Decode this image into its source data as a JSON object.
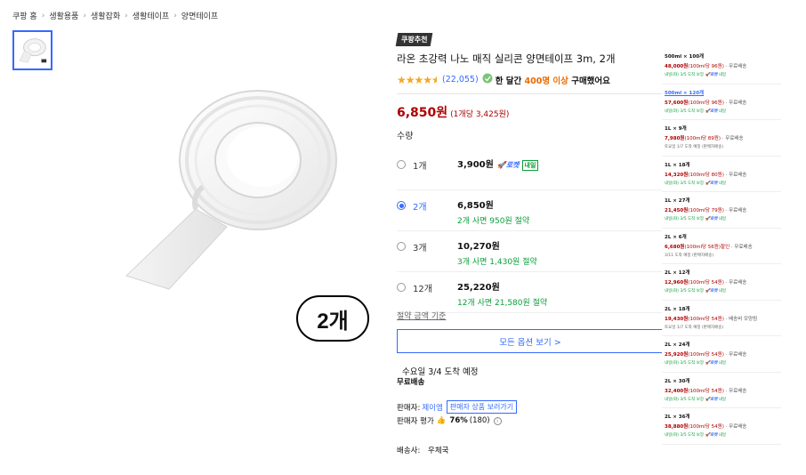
{
  "breadcrumb": [
    "쿠팡 홈",
    "생활용품",
    "생활잡화",
    "생활테이프",
    "양면테이프"
  ],
  "badge_text": "2개",
  "recommend_badge": "쿠팡추천",
  "title": "라온 초강력 나노 매직 실리콘 양면테이프 3m, 2개",
  "rating": {
    "stars": 4.5,
    "review_count": "(22,055)",
    "buy_prefix": "한 달간",
    "buy_highlight": "400명 이상",
    "buy_suffix": "구매했어요"
  },
  "price": {
    "main": "6,850원",
    "unit": "(1개당 3,425원)"
  },
  "quantity_label": "수량",
  "options": [
    {
      "label": "1개",
      "price": "3,900원",
      "save": "",
      "rocket": "로켓",
      "rocket_day": "내일",
      "selected": false
    },
    {
      "label": "2개",
      "price": "6,850원",
      "save": "2개 사면 950원 절약",
      "rocket": "",
      "rocket_day": "",
      "selected": true
    },
    {
      "label": "3개",
      "price": "10,270원",
      "save": "3개 사면 1,430원 절약",
      "rocket": "",
      "rocket_day": "",
      "selected": false
    },
    {
      "label": "12개",
      "price": "25,220원",
      "save": "12개 사면 21,580원 절약",
      "rocket": "",
      "rocket_day": "",
      "selected": false
    }
  ],
  "save_criteria": "절약 금액 기준",
  "all_options": "모든 옵션 보기 >",
  "delivery": {
    "date": "수요일 3/4 도착 예정",
    "free": "무료배송"
  },
  "seller": {
    "label": "판매자:",
    "name": "제이엠",
    "link": "판매자 상품 보러가기"
  },
  "seller_rating": {
    "label": "판매자 평가",
    "pct": "76%",
    "count": "(180)"
  },
  "shipping_company": {
    "label": "배송사:",
    "value": "우체국"
  },
  "side_panel": [
    {
      "name": "500ml × 100개",
      "price": "48,000원",
      "unit": "(100ml당 96원)",
      "ship": "· 무료배송",
      "eta": "내일(화) 3/5 도착 보장",
      "rocket": true,
      "link": false
    },
    {
      "name": "500ml × 120개",
      "price": "57,600원",
      "unit": "(100ml당 96원)",
      "ship": "· 무료배송",
      "eta": "내일(화) 3/5 도착 보장",
      "rocket": true,
      "link": true
    },
    {
      "name": "1L × 9개",
      "price": "7,980원",
      "unit": "(100ml당 89원)",
      "ship": "· 무료배송",
      "eta": "토요일 1/7 도착 예정 (판매자배송)",
      "rocket": false,
      "link": false
    },
    {
      "name": "1L × 18개",
      "price": "14,320원",
      "unit": "(100ml당 80원)",
      "ship": "· 무료배송",
      "eta": "내일(화) 3/5 도착 보장",
      "rocket": true,
      "link": false
    },
    {
      "name": "1L × 27개",
      "price": "21,450원",
      "unit": "(100ml당 79원)",
      "ship": "· 무료배송",
      "eta": "내일(화) 3/5 도착 보장",
      "rocket": true,
      "link": false
    },
    {
      "name": "2L × 6개",
      "price": "6,680원",
      "unit": "(100ml당 56원)할인",
      "ship": "· 무료배송",
      "eta": "3/11 도착 예정 (판매자배송)",
      "rocket": false,
      "link": false
    },
    {
      "name": "2L × 12개",
      "price": "12,960원",
      "unit": "(100ml당 54원)",
      "ship": "· 무료배송",
      "eta": "내일(화) 3/5 도착 보장",
      "rocket": true,
      "link": false
    },
    {
      "name": "2L × 18개",
      "price": "19,430원",
      "unit": "(100ml당 54원)",
      "ship": "· 배송비 모양됨",
      "eta": "토요일 1/7 도착 예정 (판매자배송)",
      "rocket": false,
      "link": false
    },
    {
      "name": "2L × 24개",
      "price": "25,920원",
      "unit": "(100ml당 54원)",
      "ship": "· 무료배송",
      "eta": "내일(화) 3/5 도착 보장",
      "rocket": true,
      "link": false
    },
    {
      "name": "2L × 30개",
      "price": "32,400원",
      "unit": "(100ml당 54원)",
      "ship": "· 무료배송",
      "eta": "내일(화) 3/5 도착 보장",
      "rocket": true,
      "link": false
    },
    {
      "name": "2L × 36개",
      "price": "38,880원",
      "unit": "(100ml당 54원)",
      "ship": "· 무료배송",
      "eta": "내일(화) 3/5 도착 보장",
      "rocket": true,
      "link": false
    }
  ],
  "side_rocket_label": "로켓",
  "side_rocket_day": "내일",
  "colors": {
    "accent": "#346aff",
    "price": "#ae0000",
    "save": "#0b9f3a",
    "star": "#f5a623"
  }
}
